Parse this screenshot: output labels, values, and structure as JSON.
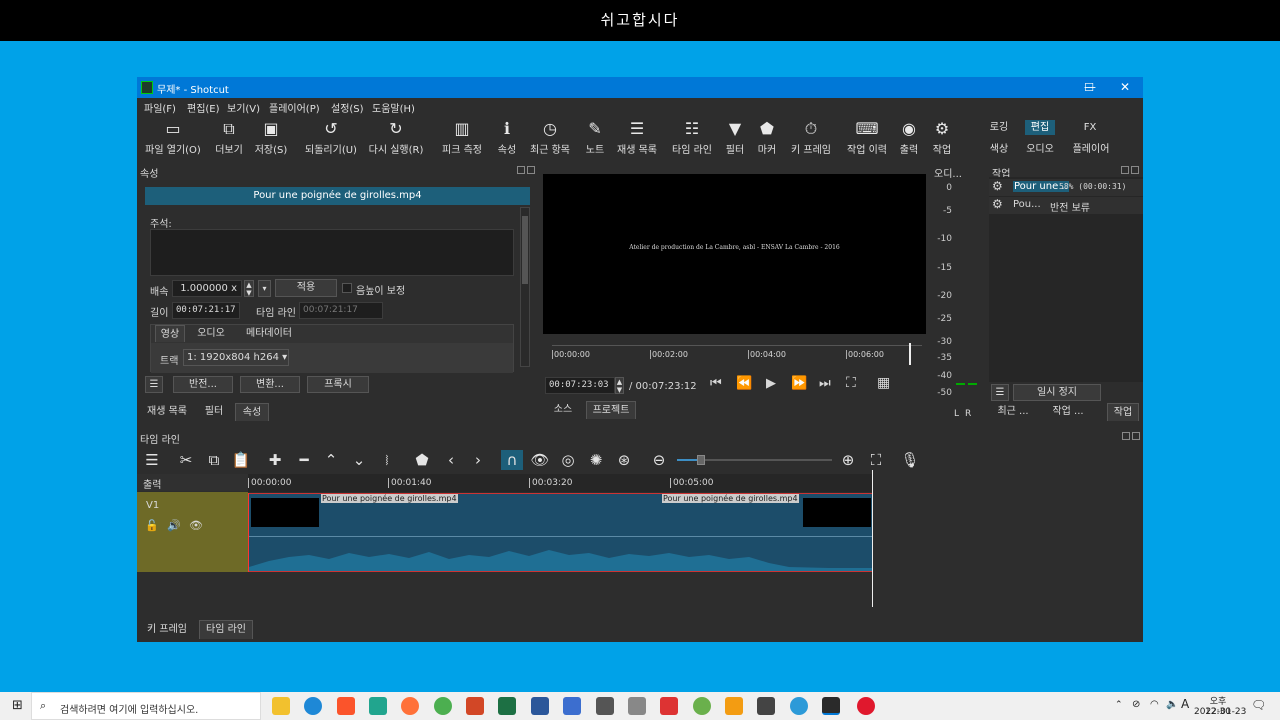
{
  "banner": {
    "title": "쉬고합시다"
  },
  "window": {
    "title": "무제* - Shotcut",
    "controls": {
      "minimize": "—",
      "maximize": "☐",
      "close": "✕"
    }
  },
  "menu": [
    "파일(F)",
    "편집(E)",
    "보기(V)",
    "플레이어(P)",
    "설정(S)",
    "도움말(H)"
  ],
  "toolbar": {
    "open": "파일 열기(O)",
    "more": "더보기",
    "save": "저장(S)",
    "undo": "되돌리기(U)",
    "redo": "다시 실행(R)",
    "peak": "피크 측정",
    "properties": "속성",
    "recent": "최근 항목",
    "notes": "노트",
    "playlist": "재생 목록",
    "timeline": "타임 라인",
    "filters": "필터",
    "markers": "마커",
    "keyframes": "키 프레임",
    "history": "작업 이력",
    "export": "출력",
    "jobs": "작업"
  },
  "layouts": {
    "logging": "로깅",
    "editing": "편집",
    "fx": "FX",
    "color": "색상",
    "audio": "오디오",
    "player": "플레이어"
  },
  "properties": {
    "header": "속성",
    "file_name": "Pour une poignée de girolles.mp4",
    "comment_label": "주석:",
    "speed_label": "배속",
    "speed_value": "1.000000 x",
    "apply_button": "적용",
    "pitch_label": "음높이 보정",
    "duration_label": "길이",
    "duration_value": "00:07:21:17",
    "timeline_label": "타임 라인",
    "timeline_value": "00:07:21:17",
    "tabs": [
      "영상",
      "오디오",
      "메타데이터"
    ],
    "track_label": "트랙",
    "track_value": "1: 1920x804 h264",
    "reverse_button": "반전...",
    "convert_button": "변환...",
    "proxy_button": "프록시",
    "bottom_tabs": [
      "재생 목록",
      "필터",
      "속성"
    ]
  },
  "player": {
    "video_caption": "Atelier de production de La Cambre, asbl - ENSAV La Cambre - 2016",
    "ruler": [
      "00:00:00",
      "00:02:00",
      "00:04:00",
      "00:06:00"
    ],
    "current_time": "00:07:23:03",
    "total_time": "/ 00:07:23:12",
    "tabs": [
      "소스",
      "프로젝트"
    ]
  },
  "audio_meter": {
    "header": "오디...",
    "scale": [
      "0",
      "-5",
      "-10",
      "-15",
      "-20",
      "-25",
      "-30",
      "-35",
      "-40",
      "-50"
    ],
    "channels": [
      "L",
      "R"
    ]
  },
  "jobs": {
    "header": "작업",
    "items": [
      {
        "name": "Pour une ..",
        "status": "58% (00:00:31)"
      },
      {
        "name": "Pou...",
        "status": "반전 보류"
      }
    ],
    "pause_button": "일시 정지",
    "bottom_tabs": [
      "최근 ...",
      "작업 ...",
      "작업"
    ]
  },
  "timeline": {
    "header": "타임 라인",
    "output_label": "출력",
    "ruler": [
      "00:00:00",
      "00:01:40",
      "00:03:20",
      "00:05:00"
    ],
    "track_name": "V1",
    "clip1": "Pour une poignée de girolles.mp4",
    "clip2": "Pour une poignée de girolles.mp4",
    "bottom_tabs": [
      "키 프레임",
      "타임 라인"
    ]
  },
  "taskbar": {
    "search_placeholder": "검색하려면 여기에 입력하십시오.",
    "time": "오후 12:30",
    "date": "2022-01-23",
    "ime": "A"
  }
}
